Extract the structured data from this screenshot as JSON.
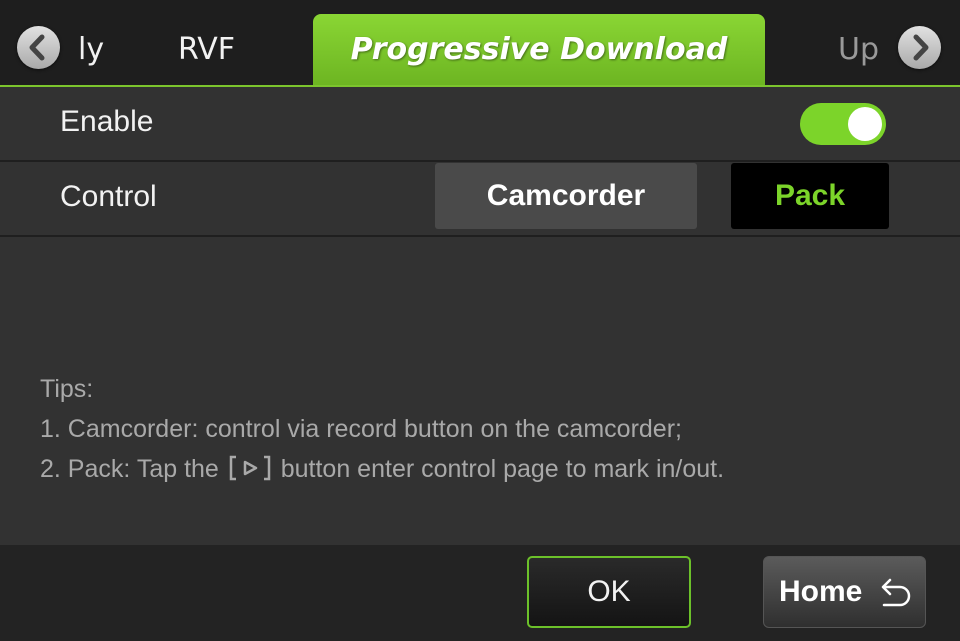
{
  "tabs": {
    "partial_left": "ly",
    "items": [
      "RVF",
      "Progressive Download"
    ],
    "active": "Progressive Download",
    "partial_right": "Up"
  },
  "settings": {
    "enable_label": "Enable",
    "enable_on": true,
    "control_label": "Control",
    "control_options": [
      "Camcorder",
      "Pack"
    ],
    "control_selected": "Pack"
  },
  "tips": {
    "title": "Tips:",
    "line1": "1. Camcorder: control via record button on the camcorder;",
    "line2_before": "2. Pack: Tap the",
    "line2_after": "button enter control page to mark in/out."
  },
  "buttons": {
    "ok": "OK",
    "home": "Home"
  },
  "colors": {
    "accent": "#7cd42a",
    "background": "#323232"
  },
  "icons": [
    "chevron-left-icon",
    "chevron-right-icon",
    "play-bracket-icon",
    "return-arrow-icon"
  ]
}
